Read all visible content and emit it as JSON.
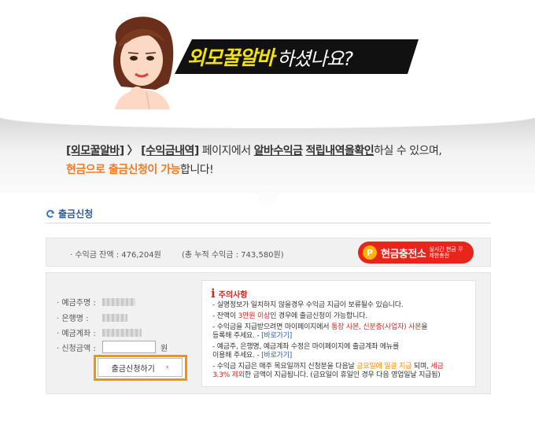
{
  "banner": {
    "highlight": "외모꿀알바",
    "rest": "하셨나요?"
  },
  "intro": {
    "path1": "[외모꿀알바]",
    "sep": "〉",
    "path2": "[수익금내역]",
    "t1": "페이지에서",
    "t2": "알바수익금",
    "t3": "적립내역을",
    "t4": "확인",
    "t5": "하실 수 있으며,",
    "hl": "현금으로 출금신청이 가능",
    "t6": "합니다!"
  },
  "section": {
    "title": "출금신청"
  },
  "balance": {
    "current": "· 수익금 잔액 : 476,204원",
    "total": "(총 누적 수익금 : 743,580원)"
  },
  "charge_button": {
    "icon": "P",
    "label": "현금충전소",
    "sub": "실시간 현금 무제한충전"
  },
  "form": {
    "holder_label": "· 예금주명 :",
    "bank_label": "· 은행명 :",
    "account_label": "· 예금계좌 :",
    "amount_label": "· 신청금액 :",
    "won": "원",
    "apply_label": "출금신청하기",
    "apply_arrow": "›"
  },
  "notice": {
    "title": "주의사항",
    "l1": "- 실명정보가 일치하지 않을경우 수익금 지급이 보류될수 있습니다.",
    "l2a": "- 잔액이 ",
    "l2b": "3만원 이상",
    "l2c": "인 경우에 출금신청이 가능합니다.",
    "l3a": "- 수익금을 지급받으려면 마이페이지에서 ",
    "l3b": "통장 사본, 신분증(사업자) 사본",
    "l3c": "을",
    "l4a": "  등록해 주세요.  - ",
    "l4b": "[바로가기]",
    "l5": "- 예금주, 은행명, 예금계좌 수정은 마이페이지에 출금계좌 메뉴를",
    "l6a": "  이용해 주세요.  - ",
    "l6b": "[바로가기]",
    "l7a": "- 수익금 지급은 매주 목요일까지 신청분을 다음날 ",
    "l7b": "금요일에 일괄 지급",
    "l7c": " 되며, ",
    "l7d": "세금",
    "l8a": "  3.3% 제외",
    "l8b": "한 금액이 지급됩니다. (금요일이 휴일인 경우 다음 영업일날 지급됨)"
  }
}
